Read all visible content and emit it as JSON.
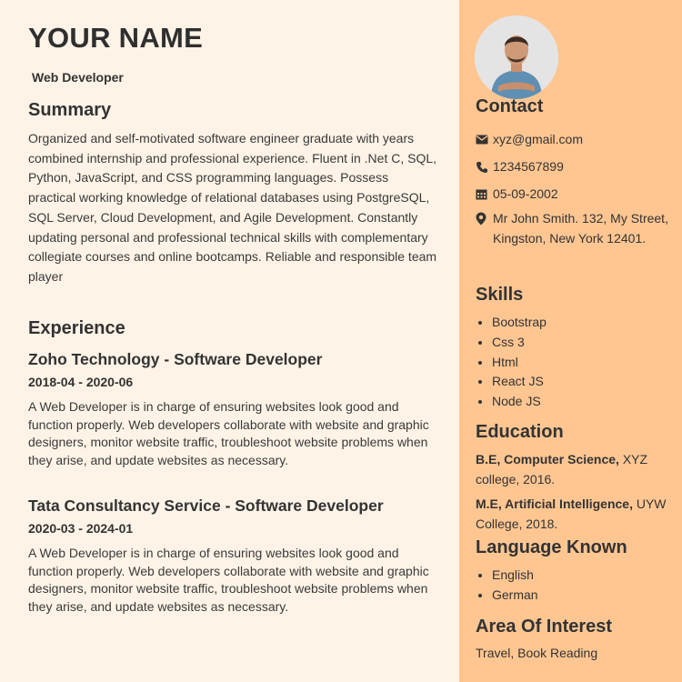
{
  "header": {
    "name": "YOUR NAME",
    "role": "Web Developer"
  },
  "summary": {
    "title": "Summary",
    "text": "Organized and self-motivated software engineer graduate with years combined internship and professional experience. Fluent in .Net C, SQL, Python, JavaScript, and CSS programming languages. Possess practical working knowledge of relational databases using PostgreSQL, SQL Server, Cloud Development, and Agile Development. Constantly updating personal and professional technical skills with complementary collegiate courses and online bootcamps. Reliable and responsible team player"
  },
  "experience": {
    "title": "Experience",
    "jobs": [
      {
        "title": "Zoho Technology - Software Developer",
        "dates": "2018-04 - 2020-06",
        "description": "A Web Developer is in charge of ensuring websites look good and function properly. Web developers collaborate with website and graphic designers, monitor website traffic, troubleshoot website problems when they arise, and update websites as necessary."
      },
      {
        "title": "Tata Consultancy Service - Software Developer",
        "dates": "2020-03 - 2024-01",
        "description": "A Web Developer is in charge of ensuring websites look good and function properly. Web developers collaborate with website and graphic designers, monitor website traffic, troubleshoot website problems when they arise, and update websites as necessary."
      }
    ]
  },
  "contact": {
    "title": "Contact",
    "email": "xyz@gmail.com",
    "phone": "1234567899",
    "dob": "05-09-2002",
    "address": "Mr John Smith. 132, My Street, Kingston, New York 12401."
  },
  "skills": {
    "title": "Skills",
    "items": [
      "Bootstrap",
      "Css 3",
      "Html",
      "React JS",
      "Node JS"
    ]
  },
  "education": {
    "title": "Education",
    "entries": [
      {
        "degree": "B.E, Computer Science,",
        "school": "XYZ college, 2016."
      },
      {
        "degree": "M.E, Artificial Intelligence,",
        "school": "UYW College, 2018."
      }
    ]
  },
  "languages": {
    "title": "Language Known",
    "items": [
      "English",
      "German"
    ]
  },
  "interest": {
    "title": "Area Of Interest",
    "text": "Travel, Book Reading"
  },
  "colors": {
    "main_bg": "#fef3e6",
    "sidebar_bg": "#ffc692",
    "text": "#333333"
  },
  "icons": {
    "email": "envelope-icon",
    "phone": "phone-icon",
    "dob": "calendar-icon",
    "address": "location-pin-icon"
  }
}
